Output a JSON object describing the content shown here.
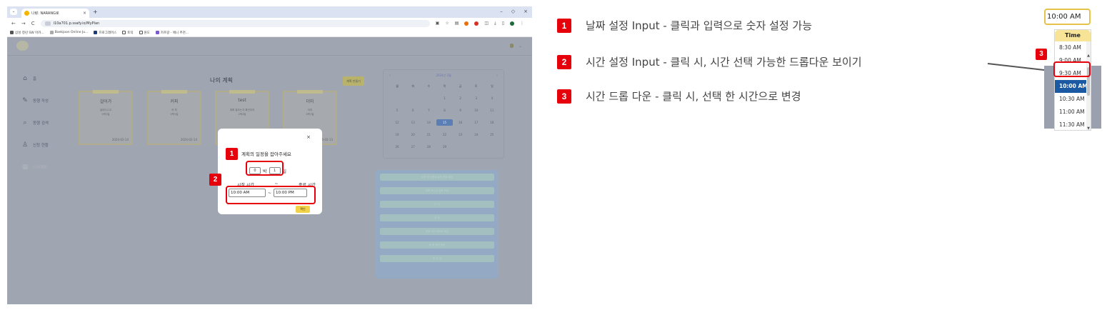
{
  "browser": {
    "tab_title": "나랑: NARANG로",
    "url": "i10a701.p.ssafy.io/MyPlan",
    "bookmarks": [
      "삼성 청년 SW 아카...",
      "Baekjoon Online Ju...",
      "프로그래머스",
      "토익",
      "원도",
      "카프랑 - 애니 추천..."
    ]
  },
  "sidebar": {
    "items": [
      {
        "icon": "home-icon",
        "label": "홈"
      },
      {
        "icon": "pencil-icon",
        "label": "동행 작성"
      },
      {
        "icon": "search-icon",
        "label": "동행 검색"
      },
      {
        "icon": "people-icon",
        "label": "신청 현황"
      },
      {
        "icon": "calendar-icon",
        "label": "나의계획"
      }
    ]
  },
  "main": {
    "title": "나의 계획",
    "plan_button": "계획 만들기",
    "cards": [
      {
        "title": "걸어가",
        "sub": "걸어다니고\n0박1일",
        "date": "2024-02-14"
      },
      {
        "title": "커피",
        "sub": "커 피\n0박1일",
        "date": "2024-02-14"
      },
      {
        "title": "test",
        "sub": "계획 흥추는가 확인하자\n2박4일",
        "date": ""
      },
      {
        "title": "더미",
        "sub": "더미\n0박1일",
        "date": "2024-02-13"
      }
    ]
  },
  "calendar": {
    "title": "2024년 2월",
    "weekdays": [
      "월",
      "화",
      "수",
      "목",
      "금",
      "토",
      "일"
    ],
    "days": [
      "",
      "",
      "",
      "1",
      "2",
      "3",
      "4",
      "5",
      "6",
      "7",
      "8",
      "9",
      "10",
      "11",
      "12",
      "13",
      "14",
      "15",
      "16",
      "17",
      "18",
      "19",
      "20",
      "21",
      "22",
      "23",
      "24",
      "25",
      "26",
      "27",
      "28",
      "29",
      "",
      ""
    ],
    "selected_day": "15"
  },
  "events": [
    "오후 주식 중요 일정 공유 회의",
    "계획 보고서 검토 미팅",
    "아 이",
    "로 트",
    "계획 초안 마무리 공유",
    "팀 원 회의 정리",
    "최 종 검"
  ],
  "modal": {
    "close": "×",
    "title": "계획의 일정을 잡아주세요",
    "nights": "0",
    "nights_unit": "박",
    "days": "1",
    "days_unit": "일",
    "start_label": "시작 시간",
    "end_label": "종료 시간",
    "tilde": "~",
    "start_time": "10:00 AM",
    "end_time": "10:00 PM",
    "confirm": "확인"
  },
  "legend": [
    {
      "badge": "1",
      "text": "날짜 설정 Input - 클릭과 입력으로 숫자 설정 가능"
    },
    {
      "badge": "2",
      "text": "시간 설정 Input - 클릭 시, 시간 선택 가능한 드롭다운 보이기"
    },
    {
      "badge": "3",
      "text": "시간 드롭 다운 - 클릭 시, 선택 한 시간으로 변경"
    }
  ],
  "zoom": {
    "input_value": "10:00 AM",
    "header": "Time",
    "badge": "3",
    "options": [
      "8:30 AM",
      "9:00 AM",
      "9:30 AM",
      "10:00 AM",
      "10:30 AM",
      "11:00 AM",
      "11:30 AM"
    ],
    "selected": "10:00 AM"
  },
  "colors": {
    "annotation_red": "#e5000b",
    "selected_blue": "#1b5aa3",
    "confirm_yellow": "#f2d249"
  }
}
